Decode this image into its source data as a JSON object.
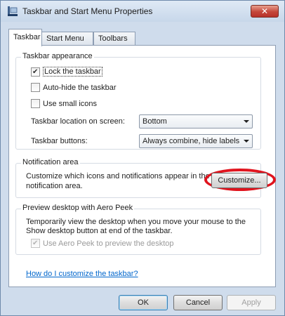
{
  "window": {
    "title": "Taskbar and Start Menu Properties",
    "close_label": "✕"
  },
  "tabs": [
    {
      "label": "Taskbar",
      "active": true
    },
    {
      "label": "Start Menu",
      "active": false
    },
    {
      "label": "Toolbars",
      "active": false
    }
  ],
  "taskbar_appearance": {
    "group_label": "Taskbar appearance",
    "lock_taskbar": {
      "label": "Lock the taskbar",
      "checked": true
    },
    "auto_hide": {
      "label": "Auto-hide the taskbar",
      "checked": false
    },
    "small_icons": {
      "label": "Use small icons",
      "checked": false
    },
    "location": {
      "label": "Taskbar location on screen:",
      "value": "Bottom"
    },
    "buttons": {
      "label": "Taskbar buttons:",
      "value": "Always combine, hide labels"
    }
  },
  "notification_area": {
    "group_label": "Notification area",
    "description_line1": "Customize which icons and notifications appear in the",
    "description_line2": "notification area.",
    "customize_button": "Customize..."
  },
  "aero_peek": {
    "group_label": "Preview desktop with Aero Peek",
    "description_line1": "Temporarily view the desktop when you move your mouse to the",
    "description_line2": "Show desktop button at end of the taskbar.",
    "use_peek": {
      "label": "Use Aero Peek to preview the desktop",
      "checked": true,
      "disabled": true
    }
  },
  "help_link": "How do I customize the taskbar?",
  "footer": {
    "ok": "OK",
    "cancel": "Cancel",
    "apply": "Apply"
  },
  "colors": {
    "annotation_ring": "#e0141e",
    "link": "#0066cc"
  }
}
